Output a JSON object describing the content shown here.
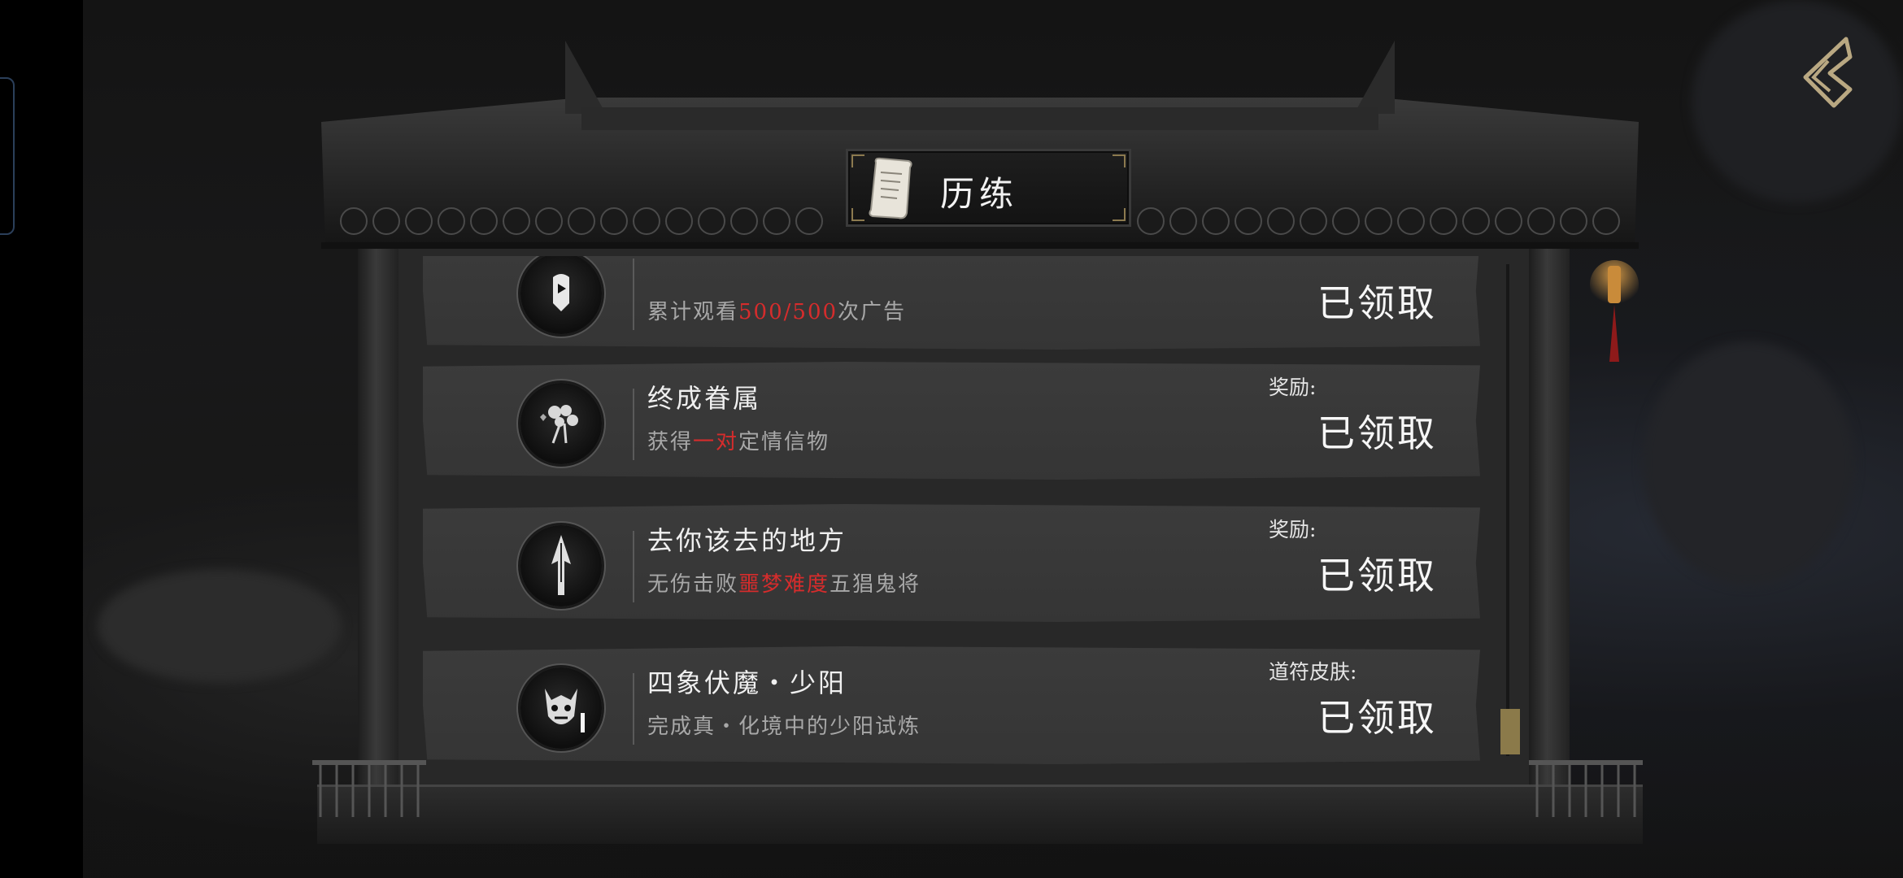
{
  "panel": {
    "title": "历练",
    "title_icon": "scroll-icon"
  },
  "tasks": [
    {
      "title": "",
      "desc_prefix": "累计观看",
      "desc_highlight": "500/500",
      "desc_suffix": "次广告",
      "reward_label": "",
      "status": "已领取",
      "icon": "ad-video-icon"
    },
    {
      "title": "终成眷属",
      "desc_prefix": "获得",
      "desc_highlight": "一对",
      "desc_suffix": "定情信物",
      "reward_label": "奖励:",
      "status": "已领取",
      "icon": "flower-bouquet-icon"
    },
    {
      "title": "去你该去的地方",
      "desc_prefix": "无伤击败",
      "desc_highlight": "噩梦难度",
      "desc_suffix": "五猖鬼将",
      "reward_label": "奖励:",
      "status": "已领取",
      "icon": "spear-icon"
    },
    {
      "title": "四象伏魔・少阳",
      "desc_prefix": "完成真・化境中的少阳试炼",
      "desc_highlight": "",
      "desc_suffix": "",
      "reward_label": "道符皮肤:",
      "status": "已领取",
      "icon": "demon-mask-icon"
    }
  ],
  "scroll": {
    "position": 0.92
  },
  "colors": {
    "highlight": "#d62c2c",
    "scroll_thumb": "#8b7a4a",
    "row_bg": "#383838"
  }
}
